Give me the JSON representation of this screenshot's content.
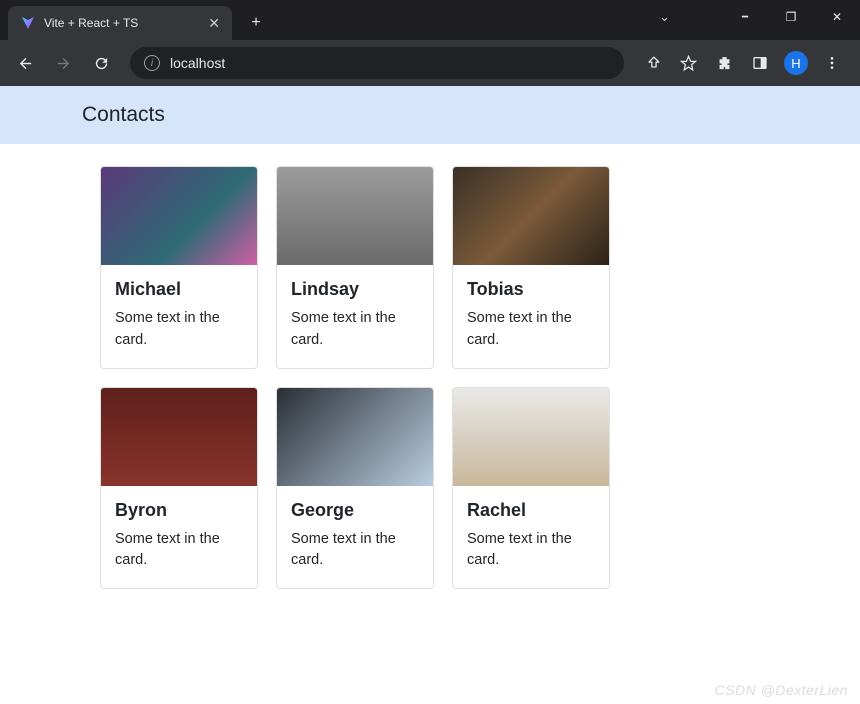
{
  "browser": {
    "tab_title": "Vite + React + TS",
    "new_tab_label": "+",
    "address": "localhost",
    "window_controls": {
      "min": "━",
      "max": "❐",
      "close": "✕"
    },
    "profile_initial": "H"
  },
  "page": {
    "heading": "Contacts",
    "card_text": "Some text in the card.",
    "contacts": [
      {
        "name": "Michael"
      },
      {
        "name": "Lindsay"
      },
      {
        "name": "Tobias"
      },
      {
        "name": "Byron"
      },
      {
        "name": "George"
      },
      {
        "name": "Rachel"
      }
    ]
  },
  "watermark": "CSDN @DexterLien"
}
